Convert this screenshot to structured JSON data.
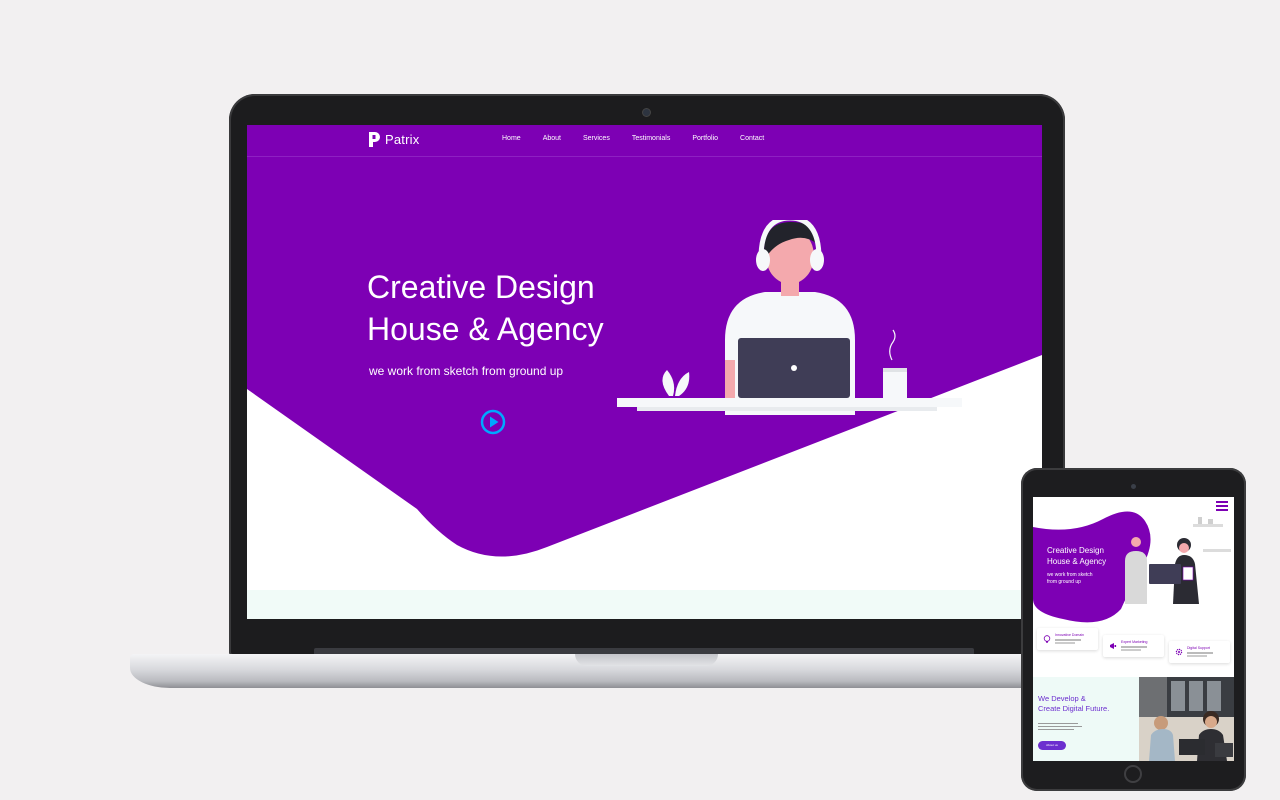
{
  "brand": {
    "name": "Patrix",
    "primary_color": "#7d00b4",
    "accent_color": "#00a8ff"
  },
  "desktop": {
    "nav": {
      "items": [
        {
          "label": "Home"
        },
        {
          "label": "About"
        },
        {
          "label": "Services"
        },
        {
          "label": "Testimonials"
        },
        {
          "label": "Portfolio"
        },
        {
          "label": "Contact"
        }
      ]
    },
    "hero": {
      "title_line1": "Creative Design",
      "title_line2": "House & Agency",
      "subtitle": "we work from sketch from ground up",
      "play_icon": "play-circle-icon"
    }
  },
  "tablet": {
    "hero": {
      "title_line1": "Creative Design",
      "title_line2": "House & Agency",
      "subtitle_line1": "we work from sketch",
      "subtitle_line2": "from ground up"
    },
    "cards": [
      {
        "label": "Innovative Domain",
        "icon": "lightbulb-icon"
      },
      {
        "label": "Expert Marketing",
        "icon": "megaphone-icon"
      },
      {
        "label": "Digital Support",
        "icon": "gear-icon"
      }
    ],
    "about": {
      "title_line1": "We Develop &",
      "title_line2": "Create Digital Future.",
      "button_label": "About us"
    },
    "menu_icon": "hamburger-icon"
  }
}
